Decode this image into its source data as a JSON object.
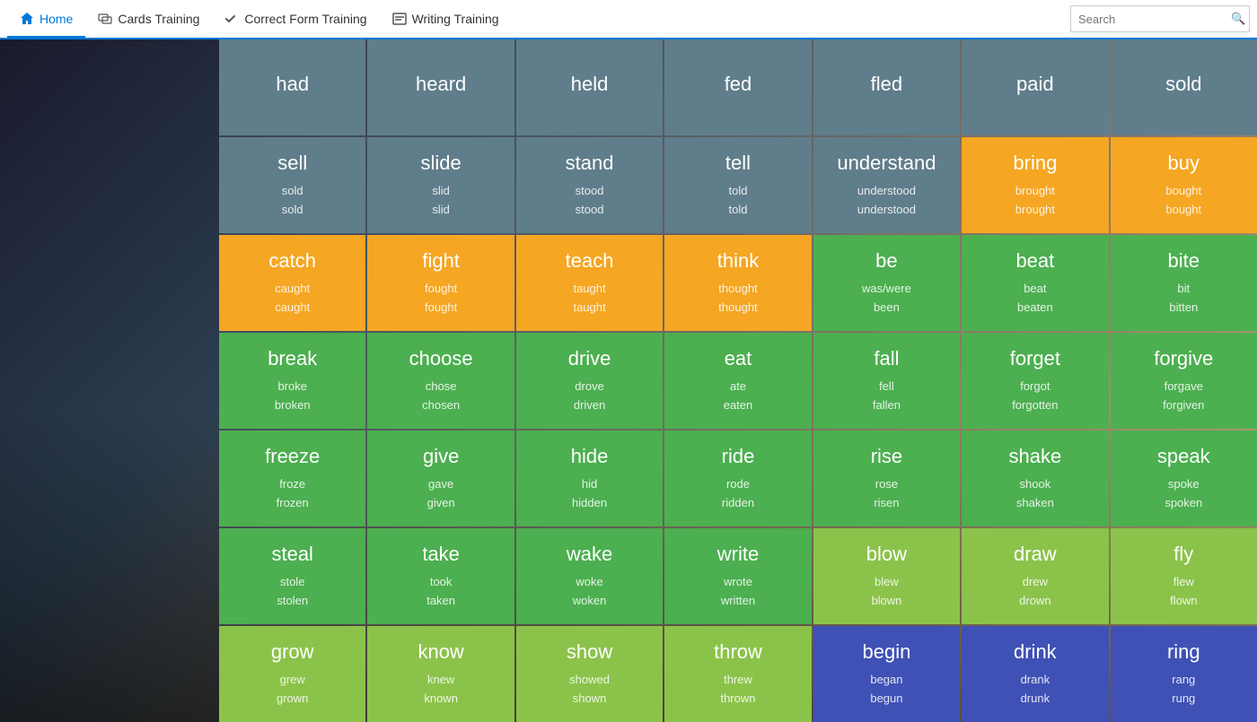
{
  "nav": {
    "home_label": "Home",
    "cards_label": "Cards Training",
    "correct_label": "Correct Form Training",
    "writing_label": "Writing Training",
    "search_placeholder": "Search"
  },
  "rows": [
    [
      {
        "word": "had",
        "f1": "",
        "f2": "",
        "color": "slate"
      },
      {
        "word": "heard",
        "f1": "",
        "f2": "",
        "color": "slate"
      },
      {
        "word": "held",
        "f1": "",
        "f2": "",
        "color": "slate"
      },
      {
        "word": "fed",
        "f1": "",
        "f2": "",
        "color": "slate"
      },
      {
        "word": "fled",
        "f1": "",
        "f2": "",
        "color": "slate"
      },
      {
        "word": "paid",
        "f1": "",
        "f2": "",
        "color": "slate"
      },
      {
        "word": "sold",
        "f1": "",
        "f2": "",
        "color": "slate"
      }
    ],
    [
      {
        "word": "sell",
        "f1": "sold",
        "f2": "sold",
        "color": "slate"
      },
      {
        "word": "slide",
        "f1": "slid",
        "f2": "slid",
        "color": "slate"
      },
      {
        "word": "stand",
        "f1": "stood",
        "f2": "stood",
        "color": "slate"
      },
      {
        "word": "tell",
        "f1": "told",
        "f2": "told",
        "color": "slate"
      },
      {
        "word": "understand",
        "f1": "understood",
        "f2": "understood",
        "color": "slate"
      },
      {
        "word": "bring",
        "f1": "brought",
        "f2": "brought",
        "color": "orange"
      },
      {
        "word": "buy",
        "f1": "bought",
        "f2": "bought",
        "color": "orange"
      }
    ],
    [
      {
        "word": "catch",
        "f1": "caught",
        "f2": "caught",
        "color": "orange"
      },
      {
        "word": "fight",
        "f1": "fought",
        "f2": "fought",
        "color": "orange"
      },
      {
        "word": "teach",
        "f1": "taught",
        "f2": "taught",
        "color": "orange"
      },
      {
        "word": "think",
        "f1": "thought",
        "f2": "thought",
        "color": "orange"
      },
      {
        "word": "be",
        "f1": "was/were",
        "f2": "been",
        "color": "green"
      },
      {
        "word": "beat",
        "f1": "beat",
        "f2": "beaten",
        "color": "green"
      },
      {
        "word": "bite",
        "f1": "bit",
        "f2": "bitten",
        "color": "green"
      }
    ],
    [
      {
        "word": "break",
        "f1": "broke",
        "f2": "broken",
        "color": "green"
      },
      {
        "word": "choose",
        "f1": "chose",
        "f2": "chosen",
        "color": "green"
      },
      {
        "word": "drive",
        "f1": "drove",
        "f2": "driven",
        "color": "green"
      },
      {
        "word": "eat",
        "f1": "ate",
        "f2": "eaten",
        "color": "green"
      },
      {
        "word": "fall",
        "f1": "fell",
        "f2": "fallen",
        "color": "green"
      },
      {
        "word": "forget",
        "f1": "forgot",
        "f2": "forgotten",
        "color": "green"
      },
      {
        "word": "forgive",
        "f1": "forgave",
        "f2": "forgiven",
        "color": "green"
      }
    ],
    [
      {
        "word": "freeze",
        "f1": "froze",
        "f2": "frozen",
        "color": "green"
      },
      {
        "word": "give",
        "f1": "gave",
        "f2": "given",
        "color": "green"
      },
      {
        "word": "hide",
        "f1": "hid",
        "f2": "hidden",
        "color": "green"
      },
      {
        "word": "ride",
        "f1": "rode",
        "f2": "ridden",
        "color": "green"
      },
      {
        "word": "rise",
        "f1": "rose",
        "f2": "risen",
        "color": "green"
      },
      {
        "word": "shake",
        "f1": "shook",
        "f2": "shaken",
        "color": "green"
      },
      {
        "word": "speak",
        "f1": "spoke",
        "f2": "spoken",
        "color": "green"
      }
    ],
    [
      {
        "word": "steal",
        "f1": "stole",
        "f2": "stolen",
        "color": "green"
      },
      {
        "word": "take",
        "f1": "took",
        "f2": "taken",
        "color": "green"
      },
      {
        "word": "wake",
        "f1": "woke",
        "f2": "woken",
        "color": "green"
      },
      {
        "word": "write",
        "f1": "wrote",
        "f2": "written",
        "color": "green"
      },
      {
        "word": "blow",
        "f1": "blew",
        "f2": "blown",
        "color": "lime"
      },
      {
        "word": "draw",
        "f1": "drew",
        "f2": "drown",
        "color": "lime"
      },
      {
        "word": "fly",
        "f1": "flew",
        "f2": "flown",
        "color": "lime"
      }
    ],
    [
      {
        "word": "grow",
        "f1": "grew",
        "f2": "grown",
        "color": "lime"
      },
      {
        "word": "know",
        "f1": "knew",
        "f2": "known",
        "color": "lime"
      },
      {
        "word": "show",
        "f1": "showed",
        "f2": "shown",
        "color": "lime"
      },
      {
        "word": "throw",
        "f1": "threw",
        "f2": "thrown",
        "color": "lime"
      },
      {
        "word": "begin",
        "f1": "began",
        "f2": "begun",
        "color": "blue"
      },
      {
        "word": "drink",
        "f1": "drank",
        "f2": "drunk",
        "color": "blue"
      },
      {
        "word": "ring",
        "f1": "rang",
        "f2": "rung",
        "color": "blue"
      }
    ]
  ]
}
